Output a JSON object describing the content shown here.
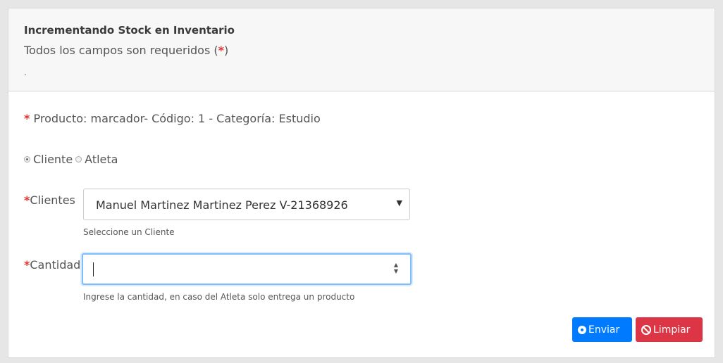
{
  "header": {
    "title": "Incrementando Stock en Inventario",
    "subtitle": "Todos los campos son requeridos",
    "subtitle_open": "(",
    "subtitle_star": "*",
    "subtitle_close": ")",
    "dot": "."
  },
  "product": {
    "star": "*",
    "text": "Producto: marcador- Código: 1 - Categoría: Estudio"
  },
  "radios": {
    "cliente": {
      "label": "Cliente",
      "checked": true
    },
    "atleta": {
      "label": "Atleta",
      "checked": false
    }
  },
  "clientes": {
    "star": "*",
    "label": "Clientes",
    "selected": "Manuel Martinez Martinez Perez V-21368926",
    "help": "Seleccione un Cliente"
  },
  "cantidad": {
    "star": "*",
    "label": "Cantidad",
    "value": "",
    "help": "Ingrese la cantidad, en caso del Atleta solo entrega un producto"
  },
  "buttons": {
    "enviar": "Enviar",
    "limpiar": "Limpiar"
  },
  "colors": {
    "primary": "#007bff",
    "danger": "#dc3545",
    "required": "#e3342f"
  }
}
